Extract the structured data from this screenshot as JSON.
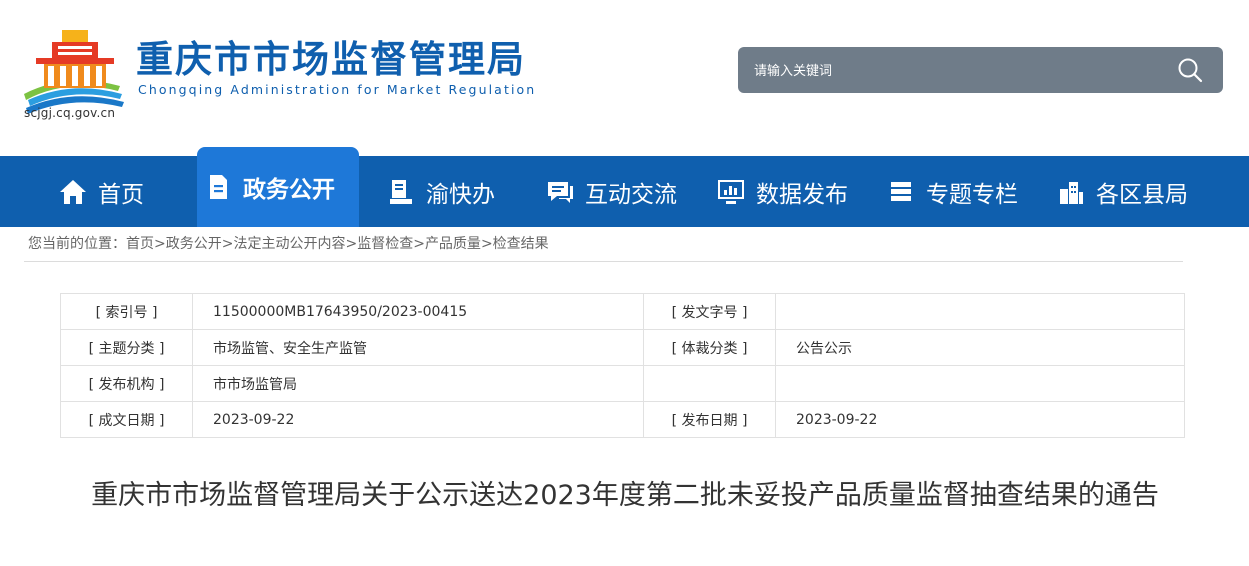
{
  "header": {
    "title": "重庆市市场监督管理局",
    "subtitle": "Chongqing  Administration for Market Regulation",
    "domain": "scjgj.cq.gov.cn",
    "logo_icon": "government-building-logo-icon"
  },
  "search": {
    "placeholder": "请输入关键词",
    "button_icon": "search-icon"
  },
  "nav": {
    "items": [
      {
        "label": "首页",
        "icon": "home-icon",
        "active": false
      },
      {
        "label": "政务公开",
        "icon": "document-icon",
        "active": true
      },
      {
        "label": "渝快办",
        "icon": "service-icon",
        "active": false
      },
      {
        "label": "互动交流",
        "icon": "chat-icon",
        "active": false
      },
      {
        "label": "数据发布",
        "icon": "monitor-chart-icon",
        "active": false
      },
      {
        "label": "专题专栏",
        "icon": "stack-icon",
        "active": false
      },
      {
        "label": "各区县局",
        "icon": "buildings-icon",
        "active": false
      }
    ]
  },
  "breadcrumb": {
    "prefix": "您当前的位置：",
    "items": [
      "首页",
      "政务公开",
      "法定主动公开内容",
      "监督检查",
      "产品质量",
      "检查结果"
    ],
    "separator": ">"
  },
  "meta": {
    "rows": [
      {
        "k1": "[ 索引号 ]",
        "v1": "11500000MB17643950/2023-00415",
        "k2": "[ 发文字号 ]",
        "v2": ""
      },
      {
        "k1": "[ 主题分类 ]",
        "v1": "市场监管、安全生产监管",
        "k2": "[ 体裁分类 ]",
        "v2": "公告公示"
      },
      {
        "k1": "[ 发布机构 ]",
        "v1": "市市场监管局",
        "k2": "",
        "v2": ""
      },
      {
        "k1": "[ 成文日期 ]",
        "v1": "2023-09-22",
        "k2": "[ 发布日期 ]",
        "v2": "2023-09-22"
      }
    ]
  },
  "article": {
    "title": "重庆市市场监督管理局关于公示送达2023年度第二批未妥投产品质量监督抽查结果的通告"
  },
  "colors": {
    "brand_blue": "#0f5fae",
    "nav_active": "#1e78d8",
    "search_bg": "#6f7c89"
  }
}
